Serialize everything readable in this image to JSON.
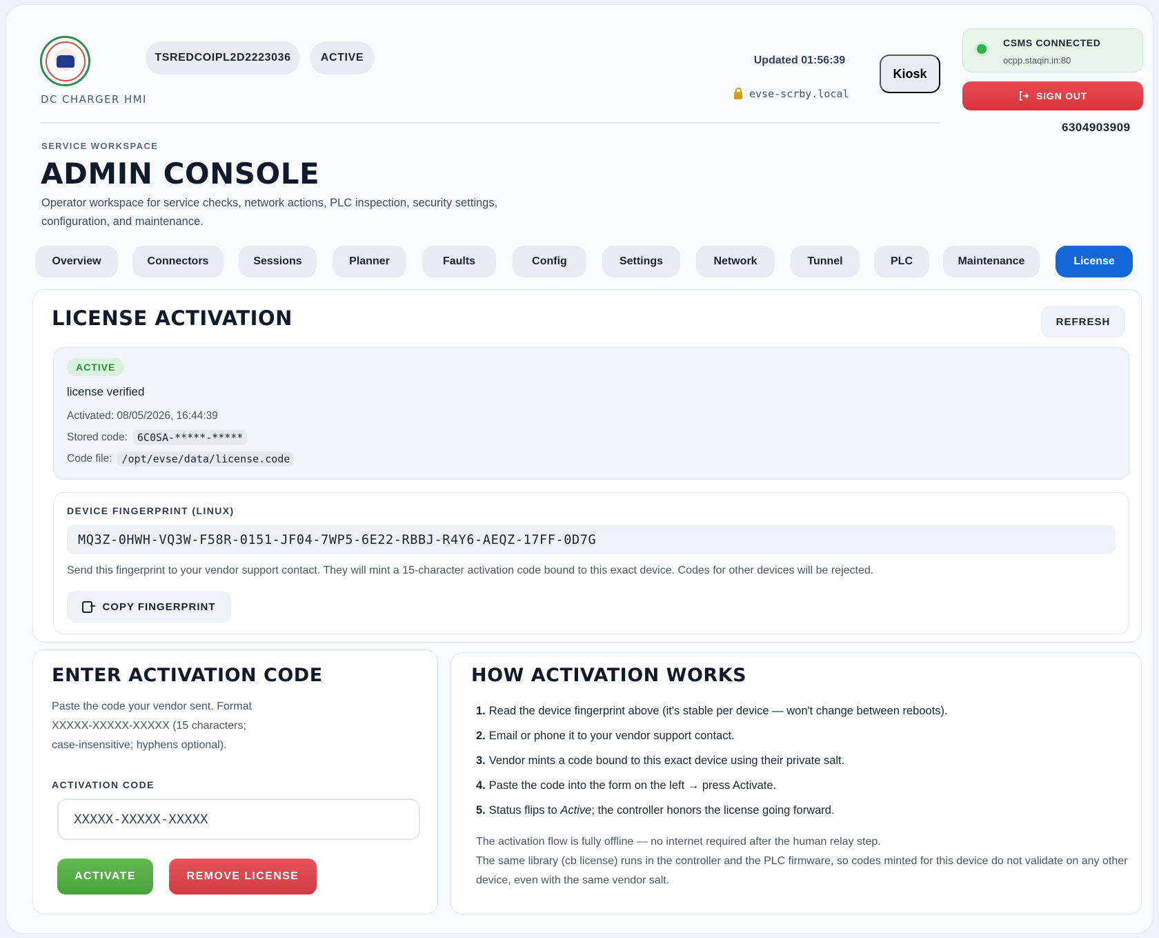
{
  "header": {
    "app_label": "DC CHARGER HMI",
    "charger_id": "TSREDCOIPL2D2223036",
    "charger_status": "ACTIVE",
    "updated": "Updated 01:56:39",
    "host": "evse-scrby.local",
    "kiosk_label": "Kiosk",
    "csms_title": "CSMS CONNECTED",
    "csms_host": "ocpp.staqin.in:80",
    "sign_out_label": "SIGN OUT",
    "phone": "6304903909"
  },
  "page": {
    "eyebrow": "SERVICE WORKSPACE",
    "title": "ADMIN CONSOLE",
    "description": "Operator workspace for service checks, network actions, PLC inspection, security settings, configuration, and maintenance."
  },
  "tabs": [
    {
      "label": "Overview"
    },
    {
      "label": "Connectors"
    },
    {
      "label": "Sessions"
    },
    {
      "label": "Planner"
    },
    {
      "label": "Faults"
    },
    {
      "label": "Config"
    },
    {
      "label": "Settings"
    },
    {
      "label": "Network"
    },
    {
      "label": "Tunnel"
    },
    {
      "label": "PLC"
    },
    {
      "label": "Maintenance"
    },
    {
      "label": "License",
      "active": true
    }
  ],
  "license": {
    "title": "LICENSE ACTIVATION",
    "refresh_label": "REFRESH",
    "status_badge": "ACTIVE",
    "status_text": "license verified",
    "activated": "Activated: 08/05/2026, 16:44:39",
    "stored_code_label": "Stored code:",
    "stored_code": "6C0SA-*****-*****",
    "code_file_label": "Code file:",
    "code_file": "/opt/evse/data/license.code"
  },
  "fingerprint": {
    "label": "DEVICE FINGERPRINT (LINUX)",
    "value": "MQ3Z-0HWH-VQ3W-F58R-0151-JF04-7WP5-6E22-RBBJ-R4Y6-AEQZ-17FF-0D7G",
    "help": "Send this fingerprint to your vendor support contact. They will mint a 15-character activation code bound to this exact device. Codes for other devices will be rejected.",
    "copy_label": "COPY FINGERPRINT"
  },
  "activation": {
    "title": "ENTER ACTIVATION CODE",
    "help": "Paste the code your vendor sent. Format XXXXX-XXXXX-XXXXX (15 characters; case-insensitive; hyphens optional).",
    "field_label": "ACTIVATION CODE",
    "placeholder": "XXXXX-XXXXX-XXXXX",
    "activate_label": "ACTIVATE",
    "remove_label": "REMOVE LICENSE"
  },
  "how": {
    "title": "HOW ACTIVATION WORKS",
    "steps": [
      {
        "num": "1.",
        "text": "Read the device fingerprint above (it's stable per device — won't change between reboots)."
      },
      {
        "num": "2.",
        "text": "Email or phone it to your vendor support contact."
      },
      {
        "num": "3.",
        "text": "Vendor mints a code bound to this exact device using their private salt."
      },
      {
        "num": "4.",
        "text": "Paste the code into the form on the left → press Activate."
      },
      {
        "num": "5.",
        "text_before": "Status flips to ",
        "text_em": "Active",
        "text_after": "; the controller honors the license going forward."
      }
    ],
    "note_1": "The activation flow is fully offline — no internet required after the human relay step.",
    "note_2": "The same library (cb license) runs in the controller and the PLC firmware, so codes minted for this device do not validate on any other device, even with the same vendor salt."
  },
  "colors": {
    "accent": "#1266d6",
    "success": "#4aa23c",
    "danger": "#d8333d"
  }
}
